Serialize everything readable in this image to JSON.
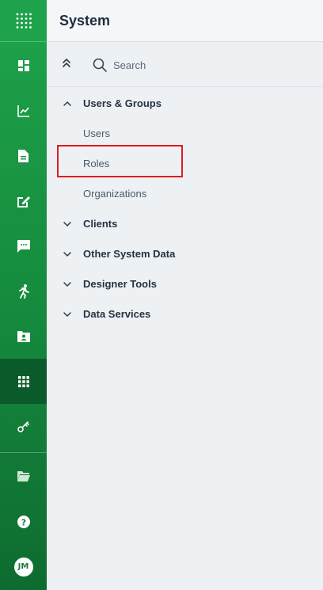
{
  "rail": {
    "top_icon": "app-grid-icon",
    "items": [
      {
        "name": "dashboard-icon"
      },
      {
        "name": "analytics-chart-icon"
      },
      {
        "name": "document-icon"
      },
      {
        "name": "edit-note-icon"
      },
      {
        "name": "chat-icon"
      },
      {
        "name": "running-person-icon"
      },
      {
        "name": "contact-folder-icon"
      },
      {
        "name": "system-grid-icon",
        "active": true
      },
      {
        "name": "key-icon"
      },
      {
        "name": "folder-icon"
      },
      {
        "name": "help-icon"
      }
    ],
    "avatar_initials": "JM"
  },
  "header": {
    "title": "System"
  },
  "toolbar": {
    "search_label": "Search"
  },
  "tree": {
    "groups": [
      {
        "label": "Users & Groups",
        "expanded": true,
        "children": [
          "Users",
          "Roles",
          "Organizations"
        ]
      },
      {
        "label": "Clients",
        "expanded": false
      },
      {
        "label": "Other System Data",
        "expanded": false
      },
      {
        "label": "Designer Tools",
        "expanded": false
      },
      {
        "label": "Data Services",
        "expanded": false
      }
    ],
    "selected": "Roles"
  },
  "colors": {
    "rail_green": "#1fa34b",
    "rail_active": "#0b5a29",
    "highlight_red": "#e01b24"
  }
}
